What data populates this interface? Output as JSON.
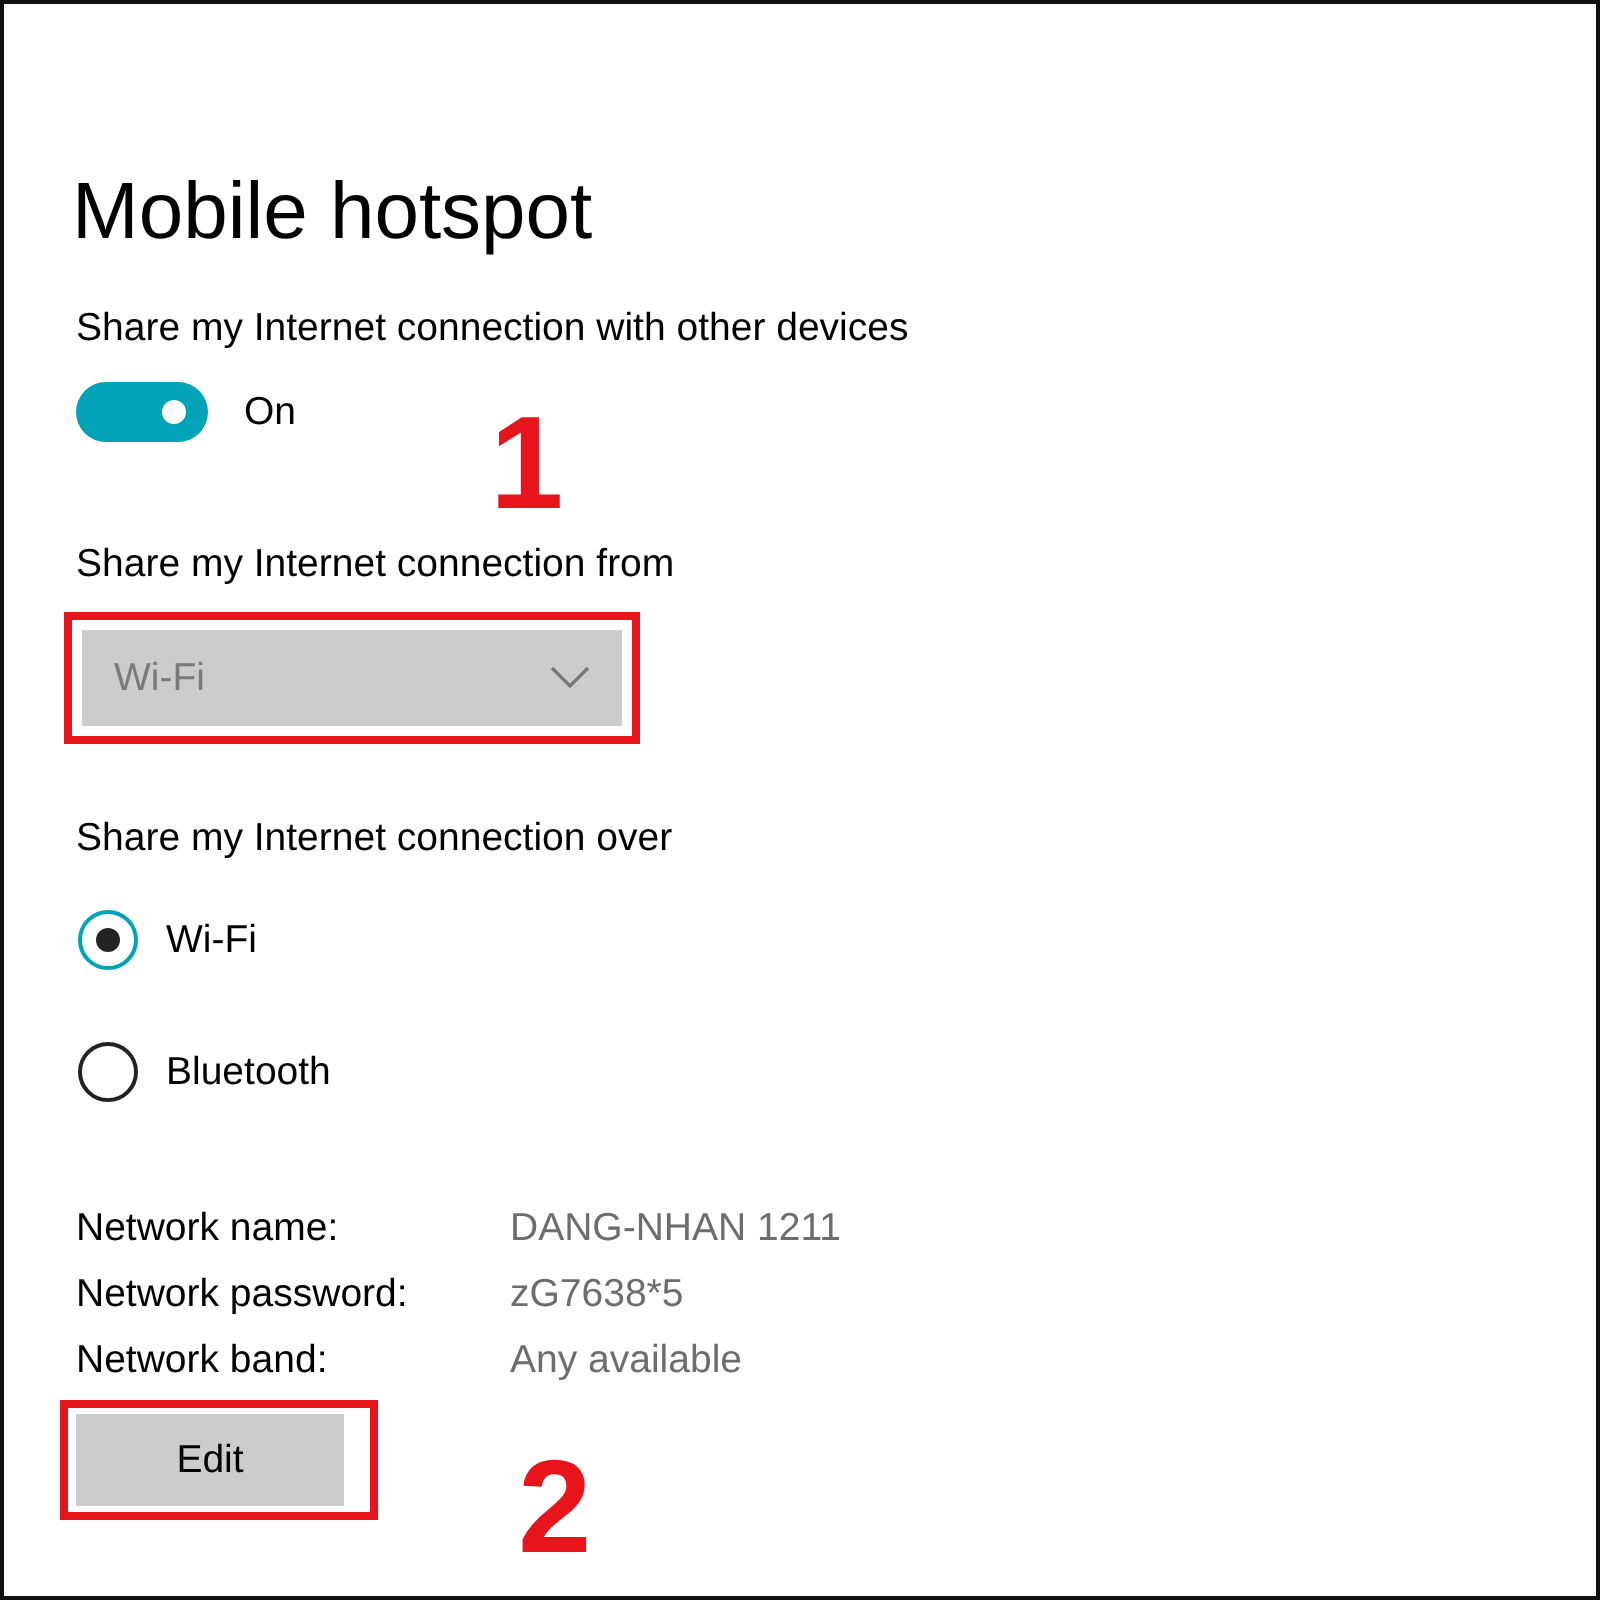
{
  "title": "Mobile hotspot",
  "share": {
    "label": "Share my Internet connection with other devices",
    "on": true,
    "state_text": "On"
  },
  "from": {
    "label": "Share my Internet connection from",
    "value": "Wi-Fi",
    "disabled": true,
    "highlighted": true,
    "step": "1"
  },
  "over": {
    "label": "Share my Internet connection over",
    "options": [
      {
        "label": "Wi-Fi",
        "selected": true
      },
      {
        "label": "Bluetooth",
        "selected": false
      }
    ]
  },
  "network": [
    {
      "label": "Network name:",
      "value": "DANG-NHAN 1211"
    },
    {
      "label": "Network password:",
      "value": "zG7638*5"
    },
    {
      "label": "Network band:",
      "value": "Any available"
    }
  ],
  "edit": {
    "label": "Edit",
    "highlighted": true,
    "step": "2"
  }
}
